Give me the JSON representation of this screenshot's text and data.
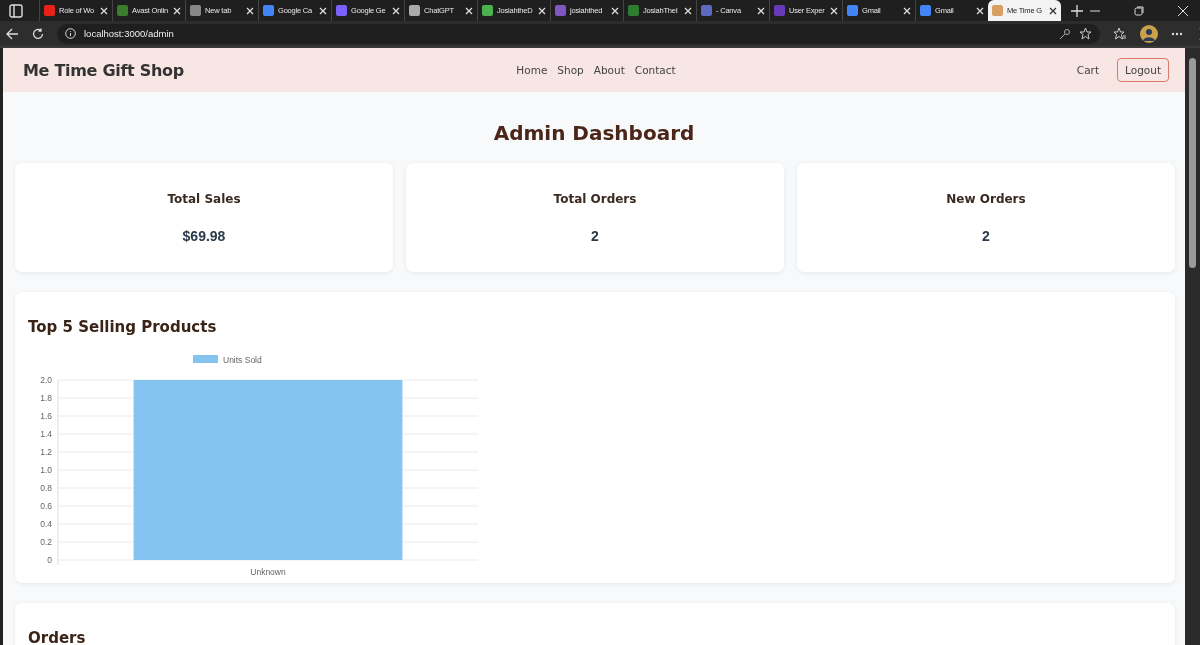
{
  "browser": {
    "tabs": [
      {
        "title": "Role of Wo",
        "selected": false
      },
      {
        "title": "Avast Onlin",
        "selected": false
      },
      {
        "title": "New tab",
        "selected": false
      },
      {
        "title": "Google Ca",
        "selected": false
      },
      {
        "title": "Google Ge",
        "selected": false
      },
      {
        "title": "ChatGPT",
        "selected": false
      },
      {
        "title": "JosiahtheD",
        "selected": false
      },
      {
        "title": "josiahthed",
        "selected": false
      },
      {
        "title": "JosiahTheI",
        "selected": false
      },
      {
        "title": "- Canva",
        "selected": false
      },
      {
        "title": "User Exper",
        "selected": false
      },
      {
        "title": "Gmail",
        "selected": false
      },
      {
        "title": "Gmail",
        "selected": false
      },
      {
        "title": "Me Time G",
        "selected": true
      }
    ],
    "address": "localhost:3000/admin"
  },
  "navbar": {
    "brand": "Me Time Gift Shop",
    "links": [
      "Home",
      "Shop",
      "About",
      "Contact"
    ],
    "cart": "Cart",
    "logout": "Logout"
  },
  "heading": "Admin Dashboard",
  "stats": [
    {
      "label": "Total Sales",
      "value": "$69.98"
    },
    {
      "label": "Total Orders",
      "value": "2"
    },
    {
      "label": "New Orders",
      "value": "2"
    }
  ],
  "chart_data": {
    "type": "bar",
    "title": "Top 5 Selling Products",
    "categories": [
      "Unknown"
    ],
    "series": [
      {
        "name": "Units Sold",
        "color": "#85c4f0",
        "values": [
          2
        ]
      }
    ],
    "ylim": [
      0,
      2
    ],
    "grid": true,
    "yticks": [
      {
        "value": 0,
        "label": "0"
      },
      {
        "value": 0.2,
        "label": "0.2"
      },
      {
        "value": 0.4,
        "label": "0.4"
      },
      {
        "value": 0.6,
        "label": "0.6"
      },
      {
        "value": 0.8,
        "label": "0.8"
      },
      {
        "value": 1,
        "label": "1.0"
      },
      {
        "value": 1.2,
        "label": "1.2"
      },
      {
        "value": 1.4,
        "label": "1.4"
      },
      {
        "value": 1.6,
        "label": "1.6"
      },
      {
        "value": 1.8,
        "label": "1.8"
      },
      {
        "value": 2,
        "label": "2.0"
      }
    ]
  },
  "orders": {
    "title": "Orders"
  }
}
